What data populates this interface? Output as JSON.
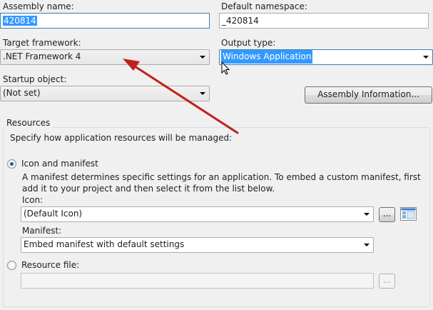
{
  "application": {
    "assembly_name": {
      "label": "Assembly name:",
      "value": "420814"
    },
    "default_namespace": {
      "label": "Default namespace:",
      "value": "_420814"
    },
    "target_framework": {
      "label": "Target framework:",
      "value": ".NET Framework 4"
    },
    "output_type": {
      "label": "Output type:",
      "value": "Windows Application"
    },
    "startup_object": {
      "label": "Startup object:",
      "value": "(Not set)"
    },
    "assembly_info_button": "Assembly Information..."
  },
  "resources": {
    "group_title": "Resources",
    "description": "Specify how application resources will be managed:",
    "icon_manifest": {
      "label": "Icon and manifest",
      "selected": true,
      "description": "A manifest determines specific settings for an application. To embed a custom manifest, first add it to your project and then select it from the list below.",
      "icon_label": "Icon:",
      "icon_value": "(Default Icon)",
      "browse_label": "...",
      "manifest_label": "Manifest:",
      "manifest_value": "Embed manifest with default settings"
    },
    "resource_file": {
      "label": "Resource file:",
      "selected": false,
      "value": "",
      "browse_label": "..."
    }
  },
  "colors": {
    "selection": "#3399ff",
    "annotation_arrow": "#c0201c"
  }
}
